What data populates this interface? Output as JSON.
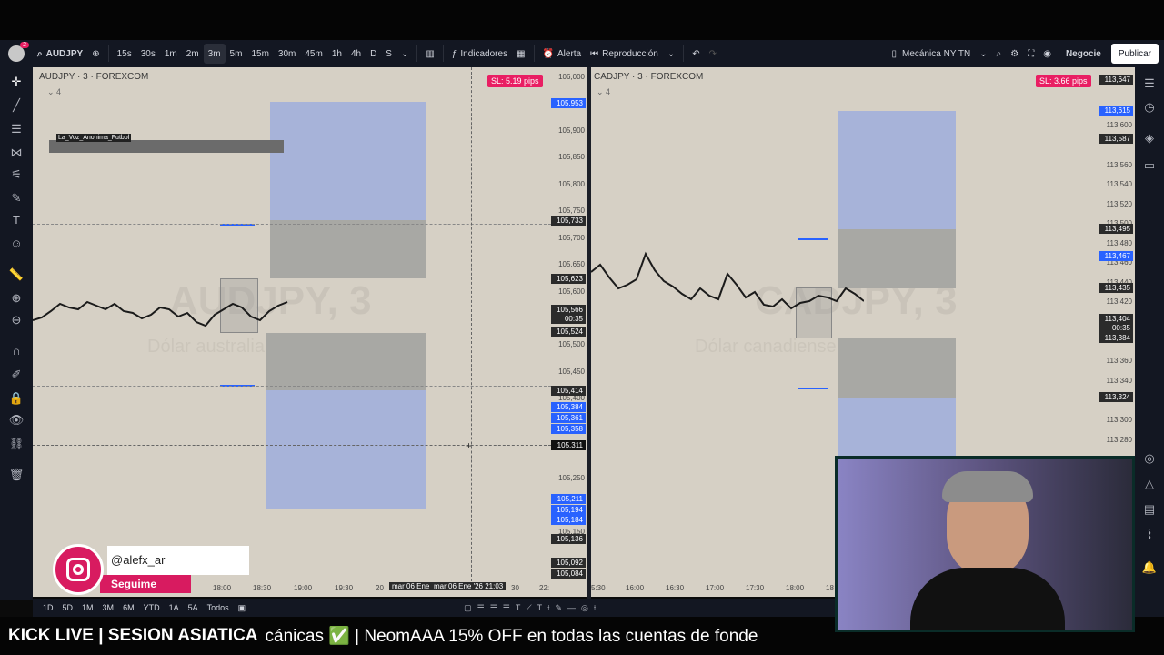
{
  "toolbar": {
    "user_badge": "2",
    "symbol": "AUDJPY",
    "intervals": [
      "15s",
      "30s",
      "1m",
      "2m",
      "3m",
      "5m",
      "15m",
      "30m",
      "45m",
      "1h",
      "4h",
      "D",
      "S"
    ],
    "active_interval": "3m",
    "indicators": "Indicadores",
    "alert": "Alerta",
    "replay": "Reproducción",
    "layout_name": "Mecánica NY TN",
    "trade": "Negocie",
    "publish": "Publicar"
  },
  "left_chart": {
    "title": "AUDJPY · 3 · FOREXCOM",
    "indicator_count": "4",
    "sl_badge": "SL: 5.19 pips",
    "label_box": "La_Voz_Anonima_Futbol",
    "watermark": "AUDJPY, 3",
    "watermark_sub": "Dólar australiano / Yen japonés",
    "axis_prices": [
      "106,000",
      "105,900",
      "105,850",
      "105,800",
      "105,750",
      "105,700",
      "105,650",
      "105,600",
      "105,500",
      "105,450",
      "105,400",
      "105,250",
      "105,150"
    ],
    "tags_blue": [
      "105,953",
      "105,384",
      "105,361",
      "105,358",
      "105,211",
      "105,194",
      "105,184"
    ],
    "tags_dark": [
      "105,733",
      "105,623",
      "105,566",
      "00:35",
      "105,524",
      "105,414",
      "105,311",
      "105,136",
      "105,092",
      "105,084"
    ],
    "time_labels": [
      "18:00",
      "18:30",
      "19:00",
      "19:30",
      "20",
      "22:",
      "30"
    ],
    "crosshair_date": "mar 06 Ene '26  21:03",
    "crosshair_date_left": "mar 06 Ene '"
  },
  "right_chart": {
    "title": "CADJPY · 3 · FOREXCOM",
    "indicator_count": "4",
    "sl_badge": "SL: 3.66 pips",
    "watermark": "CADJPY, 3",
    "watermark_sub": "Dólar canadiense / Yen japonés",
    "axis_prices": [
      "113,600",
      "113,560",
      "113,540",
      "113,520",
      "113,500",
      "113,480",
      "113,460",
      "113,440",
      "113,420",
      "113,360",
      "113,340",
      "113,300",
      "113,280"
    ],
    "tags_blue": [
      "113,615",
      "113,467"
    ],
    "tags_dark": [
      "113,647",
      "113,587",
      "113,495",
      "113,435",
      "113,404",
      "00:35",
      "113,384",
      "113,324"
    ],
    "time_labels": [
      "5:30",
      "16:00",
      "16:30",
      "17:00",
      "17:30",
      "18:00",
      "18"
    ]
  },
  "bottom_bar": {
    "ranges": [
      "1D",
      "5D",
      "1M",
      "3M",
      "6M",
      "YTD",
      "1A",
      "5A",
      "Todos"
    ]
  },
  "overlay": {
    "instagram_handle": "@alefx_ar",
    "follow": "Seguime"
  },
  "ticker": {
    "left": "KICK LIVE | SESION ASIATICA",
    "scroll": "cánicas ✅ | NeomAAA 15% OFF en todas las cuentas de fonde"
  },
  "colors": {
    "accent": "#2962ff",
    "sl": "#e91e63",
    "chart_bg": "#d6d0c5",
    "zone_blue": "#a7b3d9",
    "zone_grey": "#a8a8a4"
  }
}
